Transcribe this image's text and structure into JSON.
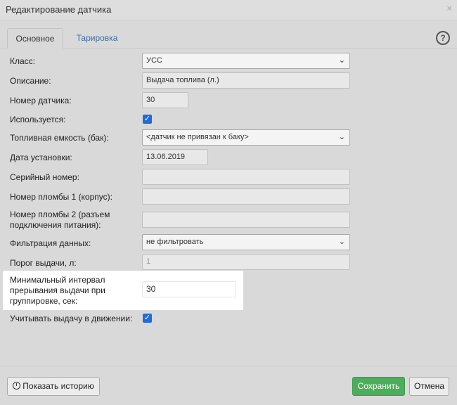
{
  "window": {
    "title": "Редактирование датчика",
    "close_glyph": "×"
  },
  "tabs": [
    {
      "label": "Основное"
    },
    {
      "label": "Тарировка"
    }
  ],
  "help_glyph": "?",
  "form": {
    "class_label": "Класс:",
    "class_value": "УСС",
    "description_label": "Описание:",
    "description_value": "Выдача топлива (л.)",
    "sensor_number_label": "Номер датчика:",
    "sensor_number_value": "30",
    "used_label": "Используется:",
    "used_checked": true,
    "tank_label": "Топливная емкость (бак):",
    "tank_value": "<датчик не привязан к баку>",
    "install_date_label": "Дата установки:",
    "install_date_value": "13.06.2019",
    "serial_label": "Серийный номер:",
    "serial_value": "",
    "seal1_label": "Номер пломбы 1 (корпус):",
    "seal1_value": "",
    "seal2_label_line1": "Номер пломбы 2 (разъем",
    "seal2_label_line2": "подключения питания):",
    "seal2_value": "",
    "filter_label": "Фильтрация данных:",
    "filter_value": "не фильтровать",
    "threshold_label": "Порог выдачи, л:",
    "threshold_value": "1",
    "interval_label_line1": "Минимальный интервал",
    "interval_label_line2": "прерывания выдачи при",
    "interval_label_line3": "группировке, сек:",
    "interval_value": "30",
    "motion_label": "Учитывать выдачу в движении:",
    "motion_checked": true
  },
  "footer": {
    "history_label": "Показать историю",
    "save_label": "Сохранить",
    "cancel_label": "Отмена"
  },
  "colors": {
    "accent_blue": "#1e6cd9",
    "save_green": "#4cad5a",
    "tab_link": "#3a6ea5"
  },
  "icons": {
    "check": "check-icon",
    "chevron": "chevron-down-icon",
    "clock": "clock-icon",
    "help": "help-circle-icon",
    "close": "close-icon"
  }
}
